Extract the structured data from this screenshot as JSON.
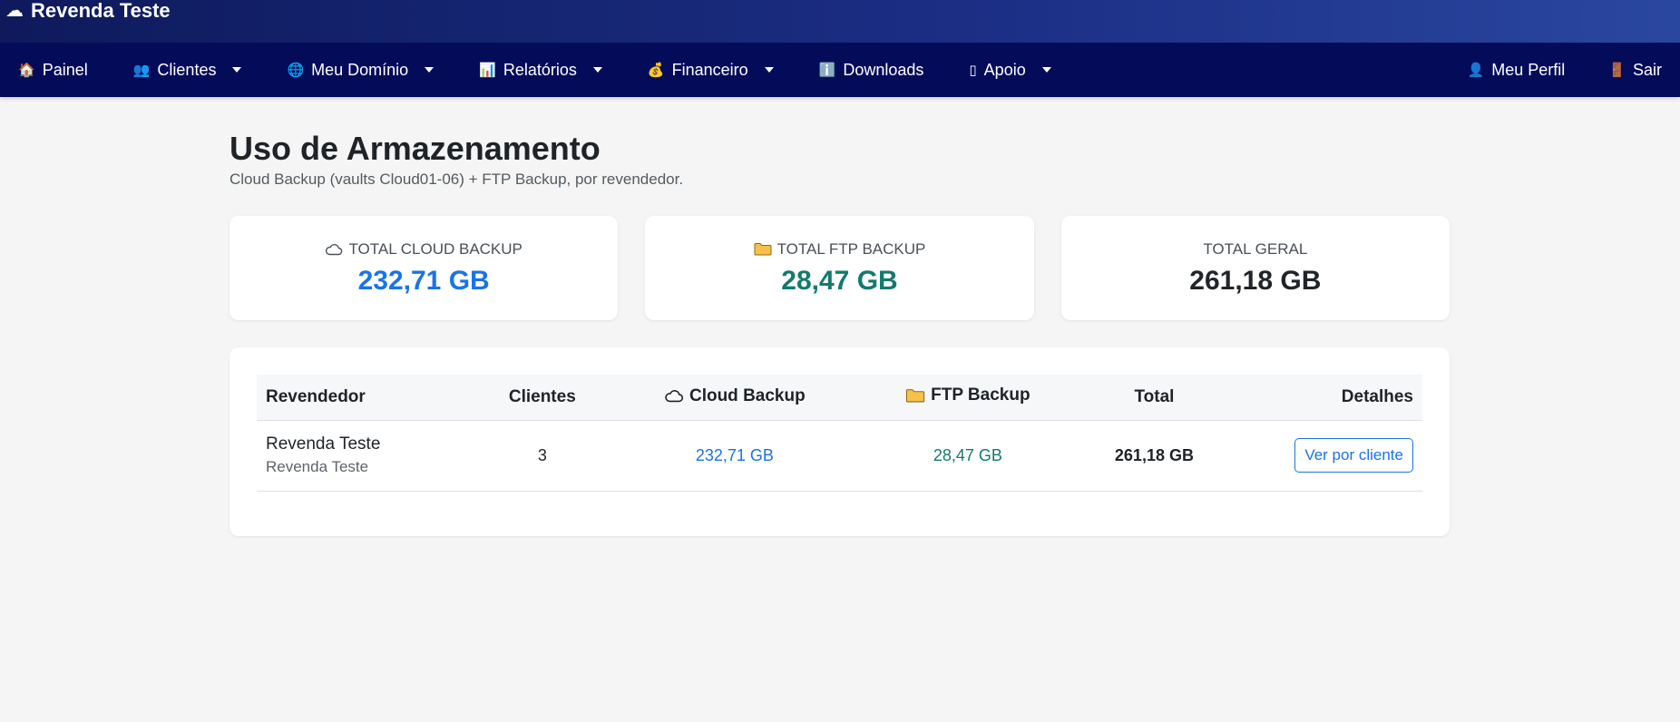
{
  "brand": {
    "title": "Revenda Teste"
  },
  "nav": {
    "left": [
      {
        "label": "Painel",
        "icon": "🏠",
        "dropdown": false
      },
      {
        "label": "Clientes",
        "icon": "👥",
        "dropdown": true
      },
      {
        "label": "Meu Domínio",
        "icon": "🌐",
        "dropdown": true
      },
      {
        "label": "Relatórios",
        "icon": "📊",
        "dropdown": true
      },
      {
        "label": "Financeiro",
        "icon": "💰",
        "dropdown": true
      },
      {
        "label": "Downloads",
        "icon": "ℹ️",
        "dropdown": false
      },
      {
        "label": "Apoio",
        "icon": "▯",
        "dropdown": true
      }
    ],
    "right": [
      {
        "label": "Meu Perfil",
        "icon": "👤"
      },
      {
        "label": "Sair",
        "icon": "🚪"
      }
    ]
  },
  "page": {
    "title": "Uso de Armazenamento",
    "subtitle": "Cloud Backup (vaults Cloud01-06) + FTP Backup, por revendedor."
  },
  "summary": {
    "cloud": {
      "label": "TOTAL CLOUD BACKUP",
      "value": "232,71 GB",
      "icon": "cloud-icon"
    },
    "ftp": {
      "label": "TOTAL FTP BACKUP",
      "value": "28,47 GB",
      "icon": "folder-icon"
    },
    "total": {
      "label": "TOTAL GERAL",
      "value": "261,18 GB"
    }
  },
  "table": {
    "headers": {
      "reseller": "Revendedor",
      "clients": "Clientes",
      "cloud": "Cloud Backup",
      "ftp": "FTP Backup",
      "total": "Total",
      "details": "Detalhes"
    },
    "rows": [
      {
        "name": "Revenda Teste",
        "sub": "Revenda Teste",
        "clients": "3",
        "cloud": "232,71 GB",
        "ftp": "28,47 GB",
        "total": "261,18 GB",
        "action": "Ver por cliente"
      }
    ]
  },
  "colors": {
    "accent": "#1a73e8",
    "ftp": "#137a6e",
    "navbar": "#040c5a"
  }
}
